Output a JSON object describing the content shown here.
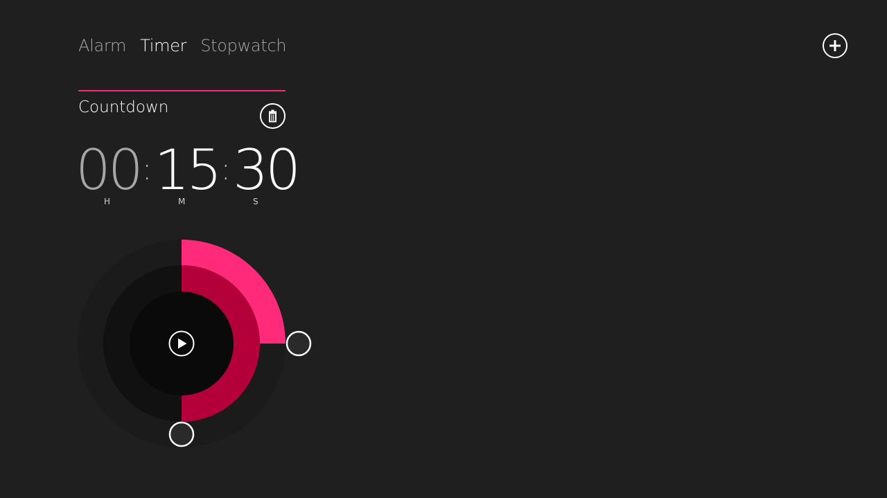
{
  "nav": {
    "tabs": [
      {
        "label": "Alarm",
        "active": false
      },
      {
        "label": "Timer",
        "active": true
      },
      {
        "label": "Stopwatch",
        "active": false
      }
    ]
  },
  "toolbar": {
    "add_icon": "plus-circle-icon"
  },
  "timer": {
    "title": "Countdown",
    "delete_icon": "trash-icon",
    "hours": "00",
    "minutes": "15",
    "seconds": "30",
    "separator": ":",
    "units": {
      "hours": "H",
      "minutes": "M",
      "seconds": "S"
    },
    "dial": {
      "play_icon": "play-icon",
      "minutes_value": 15,
      "seconds_value": 30,
      "hours_value": 0
    }
  },
  "colors": {
    "background": "#1f1f1f",
    "accent": "#ff2b7a",
    "accent_dark": "#b3003a",
    "ring_outer": "#1b1b1b",
    "ring_middle": "#111111",
    "ring_inner": "#0a0a0a"
  }
}
